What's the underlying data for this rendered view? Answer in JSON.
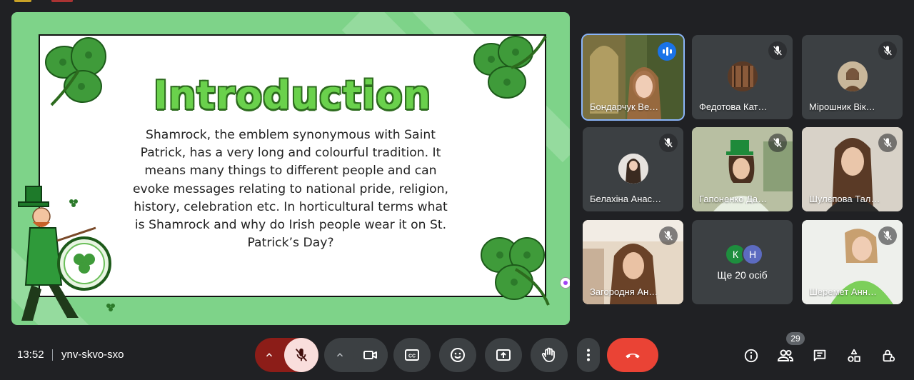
{
  "slide": {
    "title": "Introduction",
    "body": "Shamrock, the emblem synonymous with Saint Patrick, has a very long and colourful tradition. It means many things to different people and can evoke messages relating to national pride, religion, history, celebration etc. In horticultural terms what is Shamrock and why do Irish people wear it on St. Patrick’s Day?"
  },
  "participants": [
    {
      "name": "Бондарчук Ве…",
      "state": "speaking"
    },
    {
      "name": "Федотова Кат…",
      "state": "muted"
    },
    {
      "name": "Мірошник Вік…",
      "state": "muted"
    },
    {
      "name": "Белахіна Анас…",
      "state": "muted"
    },
    {
      "name": "Гапоненко Да…",
      "state": "muted"
    },
    {
      "name": "Шулєпова Тал…",
      "state": "muted"
    },
    {
      "name": "Загородня Ан…",
      "state": "muted"
    },
    {
      "name": "Шеремет Анн…",
      "state": "muted"
    }
  ],
  "more": {
    "avatars": [
      {
        "letter": "К",
        "color": "#1e8e3e"
      },
      {
        "letter": "Н",
        "color": "#5c6bc0"
      }
    ],
    "label": "Ще 20 осіб"
  },
  "bottom": {
    "time": "13:52",
    "meeting_code": "ynv-skvo-sxo",
    "participant_count": "29"
  },
  "icons": {
    "audio_options": "chevron-up-icon",
    "mic": "mic-off-icon",
    "video_options": "chevron-up-icon",
    "camera": "videocam-icon",
    "captions": "closed-caption-icon",
    "reactions": "emoji-icon",
    "present": "present-screen-icon",
    "hand": "raise-hand-icon",
    "more": "more-vert-icon",
    "leave": "call-end-icon",
    "info": "info-icon",
    "people": "people-icon",
    "chat": "chat-icon",
    "activities": "activities-icon",
    "host": "host-controls-icon"
  },
  "colors": {
    "background": "#202124",
    "tile": "#3c4043",
    "mic_off_button": "#f9dedc",
    "mic_off_group": "#8c1d18",
    "leave_button": "#ea4335",
    "active_speaker": "#8ab4f8",
    "slide_bg": "#7ed389"
  }
}
